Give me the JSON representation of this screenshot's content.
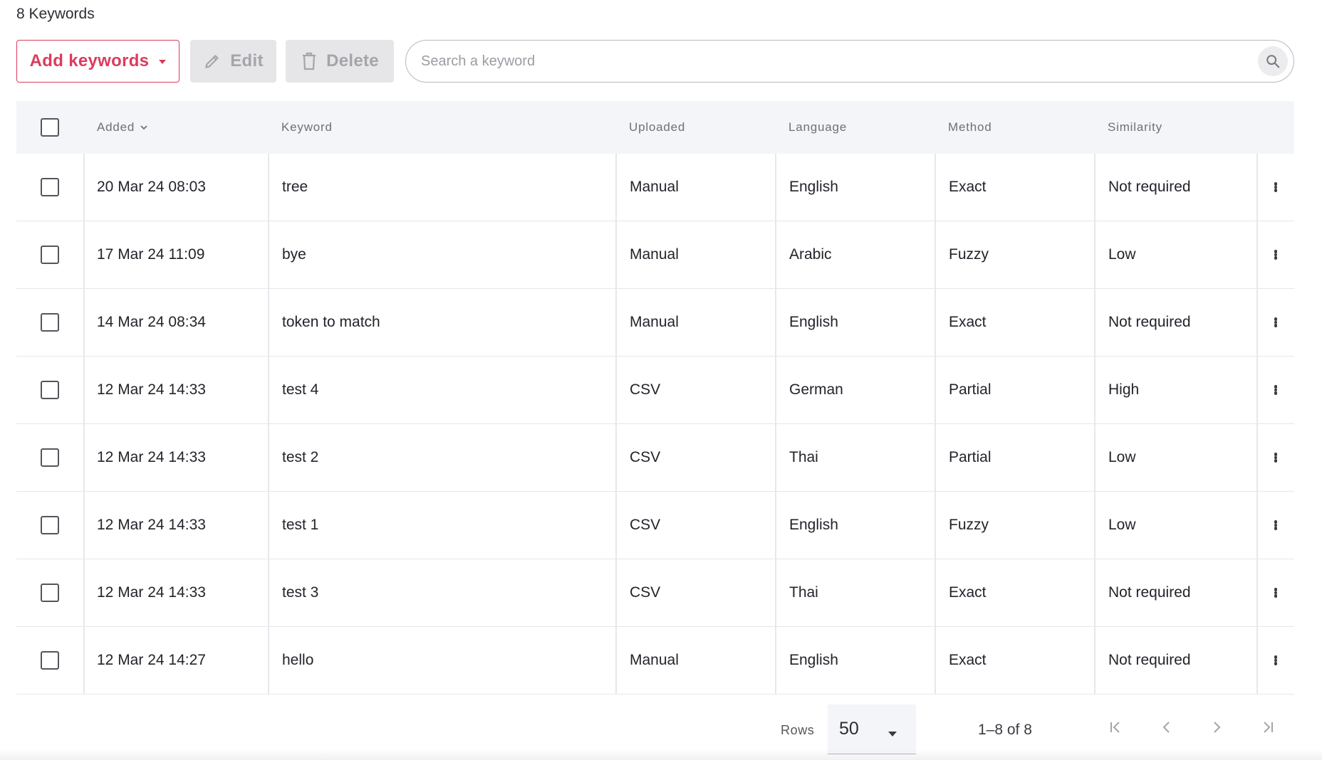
{
  "summary": {
    "count_label": "8 Keywords"
  },
  "toolbar": {
    "add_label": "Add keywords",
    "edit_label": "Edit",
    "delete_label": "Delete",
    "search_placeholder": "Search a keyword"
  },
  "table": {
    "columns": {
      "added": "Added",
      "keyword": "Keyword",
      "uploaded": "Uploaded",
      "language": "Language",
      "method": "Method",
      "similarity": "Similarity"
    },
    "sort_column": "Added",
    "rows": [
      {
        "added": "20 Mar 24 08:03",
        "keyword": "tree",
        "uploaded": "Manual",
        "language": "English",
        "method": "Exact",
        "similarity": "Not required"
      },
      {
        "added": "17 Mar 24 11:09",
        "keyword": "bye",
        "uploaded": "Manual",
        "language": "Arabic",
        "method": "Fuzzy",
        "similarity": "Low"
      },
      {
        "added": "14 Mar 24 08:34",
        "keyword": "token to match",
        "uploaded": "Manual",
        "language": "English",
        "method": "Exact",
        "similarity": "Not required"
      },
      {
        "added": "12 Mar 24 14:33",
        "keyword": "test 4",
        "uploaded": "CSV",
        "language": "German",
        "method": "Partial",
        "similarity": "High"
      },
      {
        "added": "12 Mar 24 14:33",
        "keyword": "test 2",
        "uploaded": "CSV",
        "language": "Thai",
        "method": "Partial",
        "similarity": "Low"
      },
      {
        "added": "12 Mar 24 14:33",
        "keyword": "test 1",
        "uploaded": "CSV",
        "language": "English",
        "method": "Fuzzy",
        "similarity": "Low"
      },
      {
        "added": "12 Mar 24 14:33",
        "keyword": "test 3",
        "uploaded": "CSV",
        "language": "Thai",
        "method": "Exact",
        "similarity": "Not required"
      },
      {
        "added": "12 Mar 24 14:27",
        "keyword": "hello",
        "uploaded": "Manual",
        "language": "English",
        "method": "Exact",
        "similarity": "Not required"
      }
    ]
  },
  "pagination": {
    "rows_label": "Rows",
    "rows_per_page": "50",
    "range_label": "1–8 of 8"
  },
  "colors": {
    "accent": "#dc3b5d",
    "header_bg": "#f4f5f9",
    "disabled_bg": "#e6e6e8",
    "disabled_text": "#a4a4ab"
  }
}
